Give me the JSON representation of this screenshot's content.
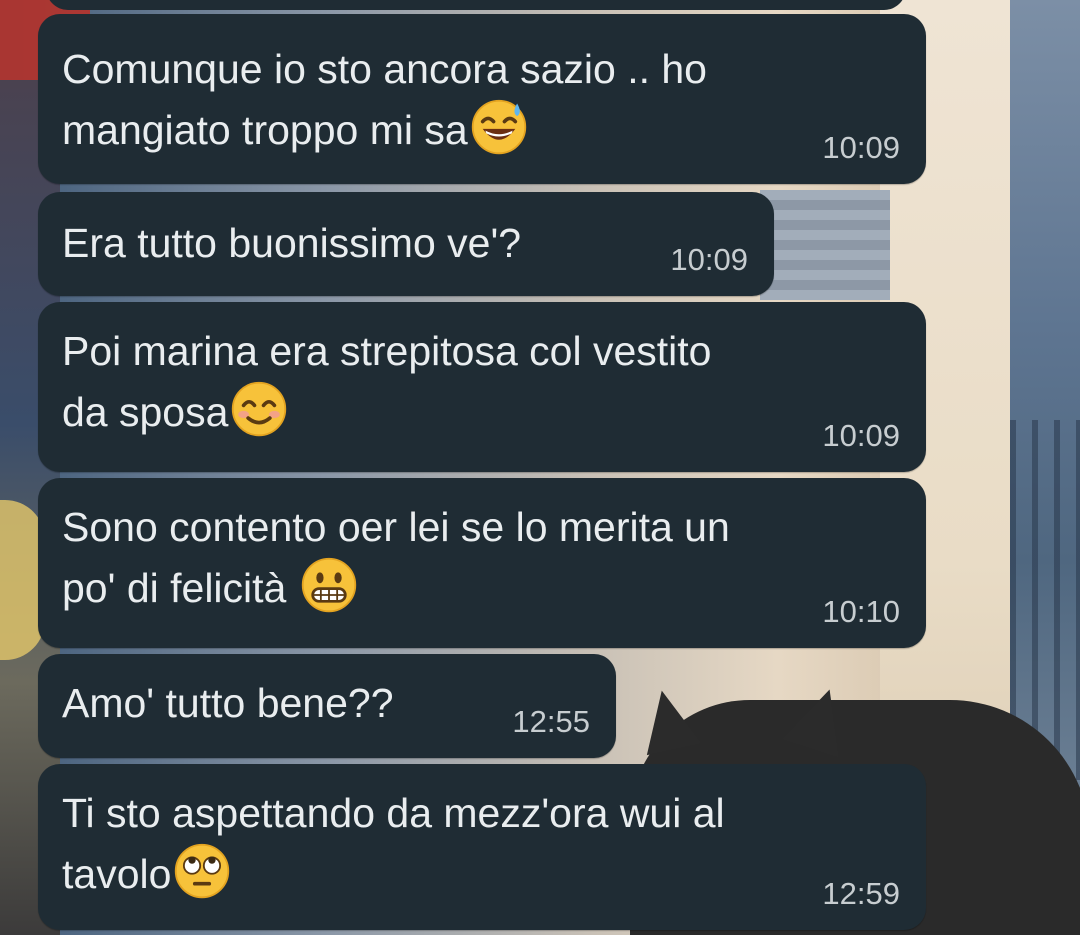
{
  "messages": [
    {
      "text": "Comunque io sto ancora sazio .. ho\nmangiato troppo mi sa",
      "emoji": "grinning-sweat-emoji",
      "time": "10:09"
    },
    {
      "text": "Era tutto buonissimo ve'?",
      "emoji": null,
      "time": "10:09"
    },
    {
      "text": "Poi marina era strepitosa col vestito\nda sposa",
      "emoji": "smiling-eyes-emoji",
      "time": "10:09"
    },
    {
      "text": "Sono contento oer lei se lo merita un\npo' di felicità ",
      "emoji": "grimacing-emoji",
      "time": "10:10"
    },
    {
      "text": "Amo' tutto bene??",
      "emoji": null,
      "time": "12:55"
    },
    {
      "text": "Ti sto aspettando da mezz'ora wui al\ntavolo",
      "emoji": "eye-roll-emoji",
      "time": "12:59"
    }
  ],
  "colors": {
    "bubble": "#1f2c34",
    "text": "#e9edef",
    "time": "#c7cdd0"
  }
}
